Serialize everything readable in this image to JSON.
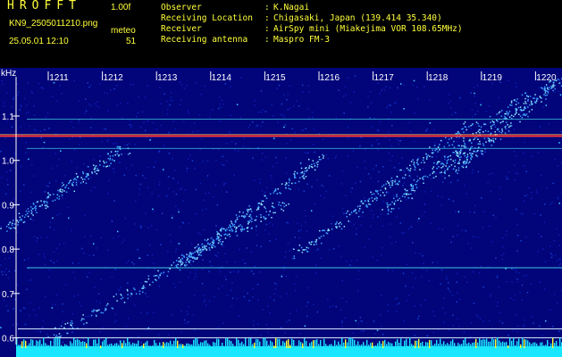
{
  "header": {
    "logo": "HROFFT",
    "version": "1.00f",
    "file_name": "KN9_2505011210.png",
    "meteor_label": "meteo",
    "date_time": "25.05.01 12:10",
    "meteor_count": "51",
    "info": [
      {
        "label": "Observer",
        "value": "K.Nagai"
      },
      {
        "label": "Receiving Location",
        "value": "Chigasaki, Japan (139.414 35.340)"
      },
      {
        "label": "Receiver",
        "value": "AirSpy mini (Miakejima VOR 108.65MHz)"
      },
      {
        "label": "Receiving antenna",
        "value": "Maspro FM-3"
      }
    ]
  },
  "plot": {
    "unit_label": "kHz",
    "y_ticks": [
      "1.1",
      "1.0",
      "0.9",
      "0.8",
      "0.7",
      "0.6"
    ],
    "minute_labels": [
      "1211",
      "1212",
      "1213",
      "1214",
      "1215",
      "1216",
      "1217",
      "1218",
      "1219",
      "1220"
    ],
    "colors": {
      "background": "#02047a",
      "text": "#ffffff",
      "carrier": "#ff3a3a",
      "echo": "#8fe8ff",
      "floor": "#19e6ff"
    }
  }
}
